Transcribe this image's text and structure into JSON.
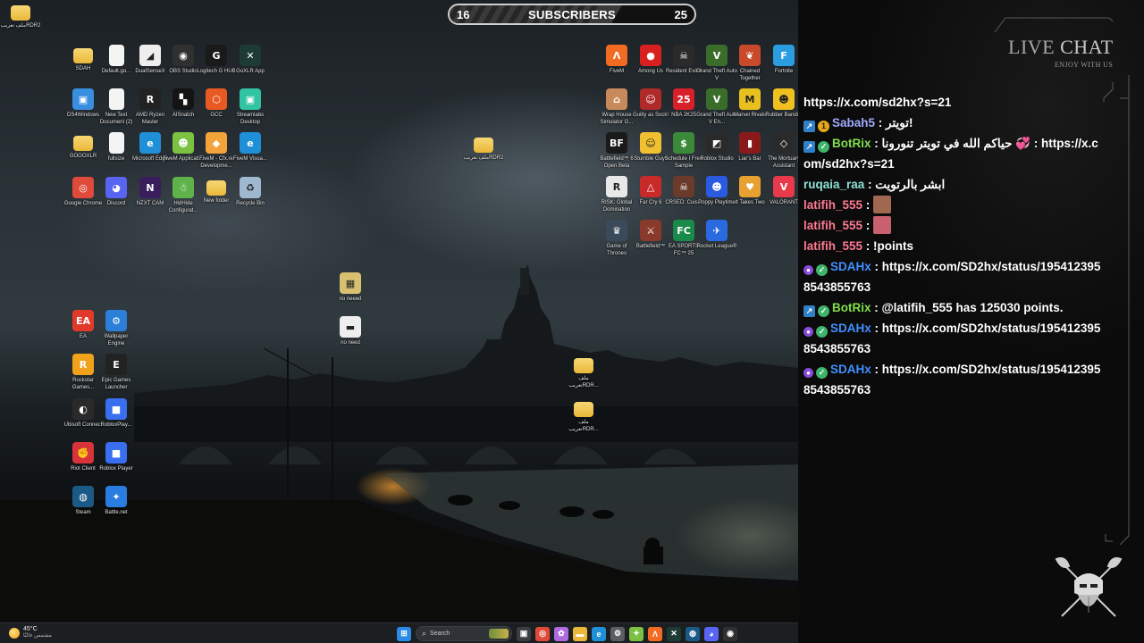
{
  "subscribers": {
    "current": "16",
    "label": "SUBSCRIBERS",
    "goal": "25",
    "progress_fraction": 0.64
  },
  "desktop_icons": [
    {
      "label": "ملف\nتعريبRDR2",
      "type": "folder",
      "color": "#e9b83a",
      "glyph": ""
    },
    {
      "label": "SDAH",
      "type": "folder",
      "color": "#e9b83a",
      "glyph": ""
    },
    {
      "label": "Default.go...",
      "type": "doc",
      "color": "#f4f4f4",
      "glyph": ""
    },
    {
      "label": "DualSenseX",
      "type": "app",
      "color": "#eeeeee",
      "glyph": "◢"
    },
    {
      "label": "OBS Studio",
      "type": "app",
      "color": "#303030",
      "glyph": "◉"
    },
    {
      "label": "Logitech G HUB",
      "type": "app",
      "color": "#1a1a1a",
      "glyph": "G"
    },
    {
      "label": "GoXLR App",
      "type": "app",
      "color": "#1e3a34",
      "glyph": "✕"
    },
    {
      "label": "DS4Windows",
      "type": "app",
      "color": "#3a8ee0",
      "glyph": "▣"
    },
    {
      "label": "New Text Document (2)",
      "type": "doc",
      "color": "#f4f4f4",
      "glyph": ""
    },
    {
      "label": "AMD Ryzen Master",
      "type": "app",
      "color": "#222222",
      "glyph": "R"
    },
    {
      "label": "AISnatch",
      "type": "app",
      "color": "#141414",
      "glyph": "▚"
    },
    {
      "label": "GCC",
      "type": "app",
      "color": "#e85a22",
      "glyph": "⬡"
    },
    {
      "label": "Streamlabs Desktop",
      "type": "app",
      "color": "#31c3a2",
      "glyph": "▣"
    },
    {
      "label": "GOOOXLR",
      "type": "folder",
      "color": "#e9b83a",
      "glyph": ""
    },
    {
      "label": "fullsize",
      "type": "doc",
      "color": "#f4f4f4",
      "glyph": ""
    },
    {
      "label": "Microsoft Edge",
      "type": "app",
      "color": "#1f8fd8",
      "glyph": "e"
    },
    {
      "label": "FiveM Applicati...",
      "type": "app",
      "color": "#7cc242",
      "glyph": "☻"
    },
    {
      "label": "FiveM - Cfx.re Developme...",
      "type": "app",
      "color": "#f2a33a",
      "glyph": "◆"
    },
    {
      "label": "FiveM Visua...",
      "type": "app",
      "color": "#1f8fd8",
      "glyph": "e"
    },
    {
      "label": "ملف\nتعريبRDR2",
      "type": "folder",
      "color": "#e9b83a",
      "glyph": ""
    },
    {
      "label": "Google Chrome",
      "type": "app",
      "color": "#e04a3a",
      "glyph": "◎"
    },
    {
      "label": "Discord",
      "type": "app",
      "color": "#5865f2",
      "glyph": "◕"
    },
    {
      "label": "NZXT CAM",
      "type": "app",
      "color": "#3a1d5c",
      "glyph": "N"
    },
    {
      "label": "HidHide Configurat...",
      "type": "app",
      "color": "#5fb24a",
      "glyph": "☃"
    },
    {
      "label": "New folder",
      "type": "folder",
      "color": "#e9b83a",
      "glyph": ""
    },
    {
      "label": "Recycle Bin",
      "type": "app",
      "color": "#9fb8d0",
      "glyph": "♻"
    },
    {
      "label": "no neeed",
      "type": "app",
      "color": "#d8c070",
      "glyph": "▦"
    },
    {
      "label": "no need",
      "type": "app",
      "color": "#eeeeee",
      "glyph": "▬"
    },
    {
      "label": "EA",
      "type": "app",
      "color": "#e23a2a",
      "glyph": "EA"
    },
    {
      "label": "Wallpaper Engine",
      "type": "app",
      "color": "#2c7fd8",
      "glyph": "⚙"
    },
    {
      "label": "Rockstar Games...",
      "type": "app",
      "color": "#f0a21a",
      "glyph": "R"
    },
    {
      "label": "Epic Games Launcher",
      "type": "app",
      "color": "#222222",
      "glyph": "E"
    },
    {
      "label": "Ubisoft Connect",
      "type": "app",
      "color": "#2a2a2a",
      "glyph": "◐"
    },
    {
      "label": "RobloxPlay...",
      "type": "app",
      "color": "#3a6ef0",
      "glyph": "■"
    },
    {
      "label": "Riot Client",
      "type": "app",
      "color": "#d8333a",
      "glyph": "✊"
    },
    {
      "label": "Roblox Player",
      "type": "app",
      "color": "#3a6ef0",
      "glyph": "■"
    },
    {
      "label": "Steam",
      "type": "app",
      "color": "#1b5a86",
      "glyph": "◍"
    },
    {
      "label": "Battle.net",
      "type": "app",
      "color": "#2a7de0",
      "glyph": "✦"
    },
    {
      "label": "ملف\nتعريبRDR...",
      "type": "folder",
      "color": "#e9b83a",
      "glyph": ""
    },
    {
      "label": "ملف\nتعريبRDR...",
      "type": "folder",
      "color": "#e9b83a",
      "glyph": ""
    },
    {
      "label": "FiveM",
      "type": "app",
      "color": "#f26b22",
      "glyph": "Λ"
    },
    {
      "label": "Among Us",
      "type": "app",
      "color": "#d92020",
      "glyph": "●"
    },
    {
      "label": "Resident Evil 4",
      "type": "app",
      "color": "#2a2a2a",
      "glyph": "☠"
    },
    {
      "label": "Grand Theft Auto V",
      "type": "app",
      "color": "#3a6d2a",
      "glyph": "V"
    },
    {
      "label": "Chained Together",
      "type": "app",
      "color": "#c84a2a",
      "glyph": "❦"
    },
    {
      "label": "Fortnite",
      "type": "app",
      "color": "#2a9de0",
      "glyph": "F"
    },
    {
      "label": "Wrap House Simulator G...",
      "type": "app",
      "color": "#c88a5a",
      "glyph": "⌂"
    },
    {
      "label": "Guilty as Sock!",
      "type": "app",
      "color": "#b02a2a",
      "glyph": "☺"
    },
    {
      "label": "NBA 2K25",
      "type": "app",
      "color": "#d8202a",
      "glyph": "25"
    },
    {
      "label": "Grand Theft Auto V En...",
      "type": "app",
      "color": "#3a6d2a",
      "glyph": "V"
    },
    {
      "label": "Marvel Rivals",
      "type": "app",
      "color": "#e8c020",
      "glyph": "M"
    },
    {
      "label": "Rubber Bandits",
      "type": "app",
      "color": "#f0c020",
      "glyph": "☻"
    },
    {
      "label": "Battlefield™ 6 Open Beta",
      "type": "app",
      "color": "#1a1a1a",
      "glyph": "BF"
    },
    {
      "label": "Stumble Guys",
      "type": "app",
      "color": "#f0c030",
      "glyph": "☺"
    },
    {
      "label": "Schedule I Free Sample",
      "type": "app",
      "color": "#3a8a3a",
      "glyph": "$"
    },
    {
      "label": "Roblox Studio",
      "type": "app",
      "color": "#2a2a2a",
      "glyph": "◩"
    },
    {
      "label": "Liar's Bar",
      "type": "app",
      "color": "#8a1a1a",
      "glyph": "▮"
    },
    {
      "label": "The Mortuary Assistant",
      "type": "app",
      "color": "#2a2a2a",
      "glyph": "◇"
    },
    {
      "label": "RISK: Global Domination",
      "type": "app",
      "color": "#e8e8e8",
      "glyph": "R"
    },
    {
      "label": "Far Cry 6",
      "type": "app",
      "color": "#c82a2a",
      "glyph": "△"
    },
    {
      "label": "CRSED: Cuis...",
      "type": "app",
      "color": "#6a3a2a",
      "glyph": "☠"
    },
    {
      "label": "Poppy Playtime",
      "type": "app",
      "color": "#2a5ae0",
      "glyph": "☻"
    },
    {
      "label": "It Takes Two",
      "type": "app",
      "color": "#e8a030",
      "glyph": "♥"
    },
    {
      "label": "VALORANT",
      "type": "app",
      "color": "#e83a4a",
      "glyph": "V"
    },
    {
      "label": "Game of Thrones",
      "type": "app",
      "color": "#3a4a5a",
      "glyph": "♛"
    },
    {
      "label": "Battlefield™",
      "type": "app",
      "color": "#8a3a2a",
      "glyph": "⚔"
    },
    {
      "label": "EA SPORTS FC™ 25",
      "type": "app",
      "color": "#1a8a4a",
      "glyph": "FC"
    },
    {
      "label": "Rocket League®",
      "type": "app",
      "color": "#2a6ae0",
      "glyph": "✈"
    }
  ],
  "chat_title": {
    "first": "LIVE",
    "second": " CHAT",
    "subtitle": "ENJOY WITH US"
  },
  "chat": [
    {
      "badges": [],
      "name": "",
      "sep": "",
      "text": "https://x.com/sd2hx?s=21"
    },
    {
      "badges": [
        "arrow",
        "coin"
      ],
      "name": "Sabah5",
      "sep": " : ",
      "text": "تويتر!"
    },
    {
      "badges": [
        "arrow",
        "check"
      ],
      "name": "BotRix",
      "sep": " : ",
      "text": "حياكم الله في تويتر تنورونا 💞 : https://x.com/sd2hx?s=21"
    },
    {
      "badges": [],
      "name": "ruqaia_raa",
      "sep": " : ",
      "text": "ابشر بالرتويت"
    },
    {
      "badges": [],
      "name": "latifih_555",
      "sep": " : ",
      "text": "",
      "emote": "#a06850"
    },
    {
      "badges": [],
      "name": "latifih_555",
      "sep": " : ",
      "text": "",
      "emote": "#c86070"
    },
    {
      "badges": [],
      "name": "latifih_555",
      "sep": " : ",
      "text": "!points"
    },
    {
      "badges": [
        "mic",
        "check"
      ],
      "name": "SDAHx",
      "sep": " : ",
      "text": "https://x.com/SD2hx/status/1954123958543855763"
    },
    {
      "badges": [
        "arrow",
        "check"
      ],
      "name": "BotRix",
      "sep": " : ",
      "text": "@latifih_555 has 125030 points."
    },
    {
      "badges": [
        "mic",
        "check"
      ],
      "name": "SDAHx",
      "sep": " : ",
      "text": "https://x.com/SD2hx/status/1954123958543855763"
    },
    {
      "badges": [
        "mic",
        "check"
      ],
      "name": "SDAHx",
      "sep": " : ",
      "text": "https://x.com/SD2hx/status/1954123958543855763"
    }
  ],
  "taskbar": {
    "weather_temp": "45°C",
    "weather_desc": "مشمس غالبًا",
    "search_placeholder": "Search",
    "icons": [
      {
        "name": "windows-start-icon",
        "color": "#2a8ae8",
        "glyph": "⊞"
      },
      {
        "name": "task-view-icon",
        "color": "#3a3e42",
        "glyph": "▣"
      },
      {
        "name": "chrome-icon",
        "color": "#e04a3a",
        "glyph": "◎"
      },
      {
        "name": "copilot-icon",
        "color": "#b06ae0",
        "glyph": "✿"
      },
      {
        "name": "file-explorer-icon",
        "color": "#e9b83a",
        "glyph": "▬"
      },
      {
        "name": "edge-icon",
        "color": "#1f8fd8",
        "glyph": "e"
      },
      {
        "name": "settings-icon",
        "color": "#5a5e62",
        "glyph": "⚙"
      },
      {
        "name": "fivem-icon",
        "color": "#7cc242",
        "glyph": "✦"
      },
      {
        "name": "fivem-cfx-icon",
        "color": "#f26b22",
        "glyph": "Λ"
      },
      {
        "name": "goxlr-icon",
        "color": "#1e3a34",
        "glyph": "✕"
      },
      {
        "name": "steam-icon",
        "color": "#1b5a86",
        "glyph": "◍"
      },
      {
        "name": "discord-icon",
        "color": "#5865f2",
        "glyph": "◕"
      },
      {
        "name": "obs-icon",
        "color": "#303030",
        "glyph": "◉"
      }
    ]
  }
}
